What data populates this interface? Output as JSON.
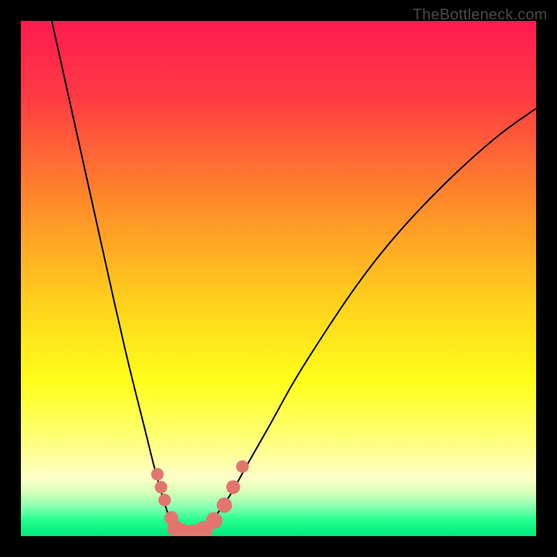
{
  "watermark": "TheBottleneck.com",
  "chart_data": {
    "type": "line",
    "title": "",
    "xlabel": "",
    "ylabel": "",
    "xlim": [
      0,
      1
    ],
    "ylim": [
      0,
      1
    ],
    "gradient_stops": [
      {
        "offset": 0.0,
        "color": "#ff1a52"
      },
      {
        "offset": 0.15,
        "color": "#ff3b42"
      },
      {
        "offset": 0.35,
        "color": "#ff8a2a"
      },
      {
        "offset": 0.55,
        "color": "#ffd21c"
      },
      {
        "offset": 0.7,
        "color": "#ffff1a"
      },
      {
        "offset": 0.82,
        "color": "#ffff80"
      },
      {
        "offset": 0.885,
        "color": "#ffffc8"
      },
      {
        "offset": 0.915,
        "color": "#d8ffb8"
      },
      {
        "offset": 0.945,
        "color": "#80ffb0"
      },
      {
        "offset": 0.97,
        "color": "#20ff90"
      },
      {
        "offset": 1.0,
        "color": "#00e878"
      }
    ],
    "series": [
      {
        "name": "bottleneck-curve",
        "x": [
          0.06,
          0.1,
          0.14,
          0.18,
          0.21,
          0.24,
          0.26,
          0.28,
          0.295,
          0.31,
          0.33,
          0.36,
          0.4,
          0.44,
          0.48,
          0.53,
          0.58,
          0.64,
          0.7,
          0.77,
          0.85,
          0.93,
          1.0
        ],
        "y": [
          1.0,
          0.82,
          0.64,
          0.46,
          0.33,
          0.21,
          0.13,
          0.06,
          0.02,
          0.005,
          0.005,
          0.02,
          0.07,
          0.14,
          0.21,
          0.3,
          0.38,
          0.47,
          0.55,
          0.63,
          0.71,
          0.78,
          0.83
        ]
      }
    ],
    "markers": {
      "name": "beads",
      "color": "#e2766f",
      "points": [
        {
          "x": 0.265,
          "y": 0.12,
          "r": 9
        },
        {
          "x": 0.272,
          "y": 0.095,
          "r": 9
        },
        {
          "x": 0.279,
          "y": 0.07,
          "r": 9
        },
        {
          "x": 0.292,
          "y": 0.035,
          "r": 10
        },
        {
          "x": 0.3,
          "y": 0.015,
          "r": 12
        },
        {
          "x": 0.315,
          "y": 0.006,
          "r": 13
        },
        {
          "x": 0.335,
          "y": 0.005,
          "r": 13
        },
        {
          "x": 0.355,
          "y": 0.012,
          "r": 13
        },
        {
          "x": 0.375,
          "y": 0.03,
          "r": 12
        },
        {
          "x": 0.395,
          "y": 0.06,
          "r": 11
        },
        {
          "x": 0.412,
          "y": 0.095,
          "r": 10
        },
        {
          "x": 0.43,
          "y": 0.135,
          "r": 9
        }
      ]
    }
  }
}
